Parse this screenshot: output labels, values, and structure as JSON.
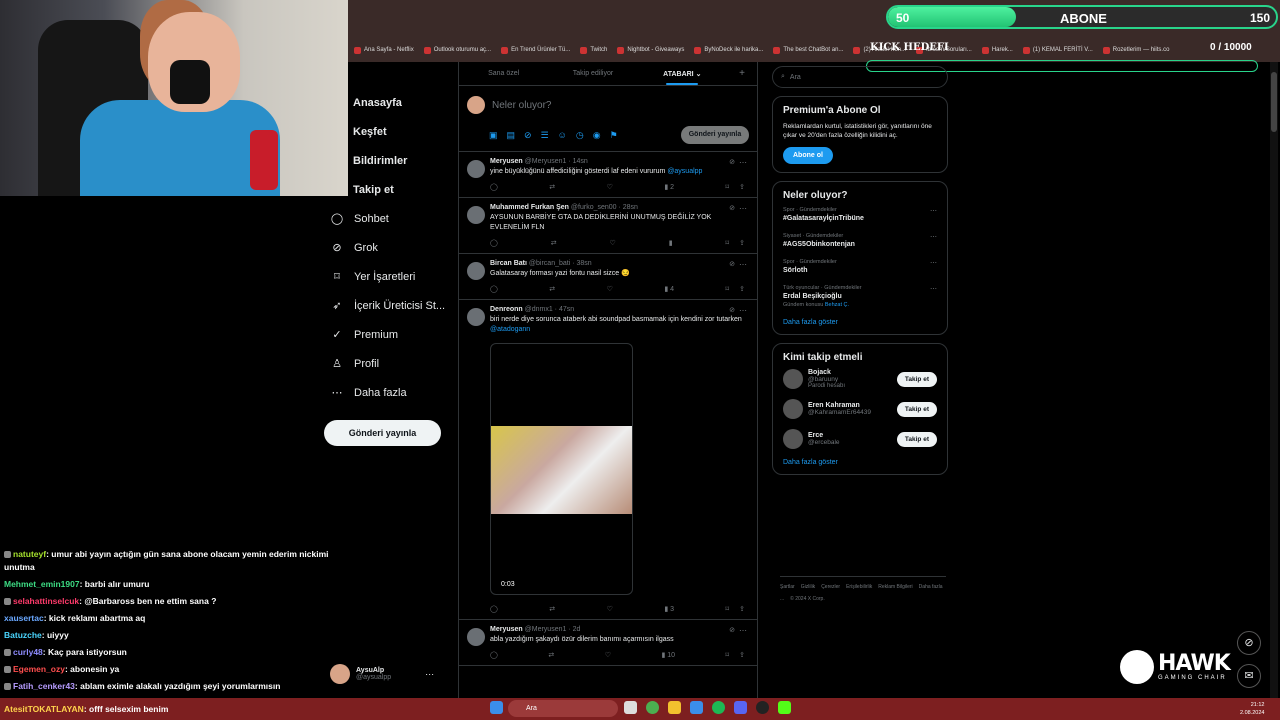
{
  "subbar": {
    "current": "50",
    "label": "ABONE",
    "goal": "150",
    "progress": 0.33
  },
  "kick": {
    "label": "KICK HEDEFI",
    "count": "0 / 10000"
  },
  "bookmarks": [
    "Ana Sayfa - Netflix",
    "Outlook oturumu aç...",
    "En Trend Ürünler Tü...",
    "Twitch",
    "Nightbot - Giveaways",
    "ByNoDeck ile harika...",
    "The best ChatBot an...",
    "(2) Aktüel Kon...",
    "fb.com/Soruları...",
    "Harek...",
    "(1) KEMAL FERİTİ V...",
    "Rozetlerim — hiits.co"
  ],
  "nav": {
    "items": [
      {
        "label": "Anasayfa",
        "icon": "home-icon"
      },
      {
        "label": "Keşfet",
        "icon": "explore-icon"
      },
      {
        "label": "Bildirimler",
        "icon": "bell-icon"
      },
      {
        "label": "Takip et",
        "icon": "follow-icon"
      },
      {
        "label": "Sohbet",
        "icon": "chat-icon",
        "glyph": "◯"
      },
      {
        "label": "Grok",
        "icon": "grok-icon",
        "glyph": "⊘"
      },
      {
        "label": "Yer İşaretleri",
        "icon": "bookmark-icon",
        "glyph": "⌑"
      },
      {
        "label": "İçerik Üreticisi St...",
        "icon": "rocket-icon",
        "glyph": "➶"
      },
      {
        "label": "Premium",
        "icon": "premium-icon",
        "glyph": "✓"
      },
      {
        "label": "Profil",
        "icon": "profile-icon",
        "glyph": "♙"
      },
      {
        "label": "Daha fazla",
        "icon": "more-icon",
        "glyph": "⋯"
      }
    ],
    "post_button": "Gönderi yayınla"
  },
  "profile": {
    "name": "AysuAlp",
    "handle": "@aysualpp"
  },
  "tabs": [
    "Sana özel",
    "Takip ediliyor",
    "ATABARI ⌄"
  ],
  "composer": {
    "placeholder": "Neler oluyor?",
    "post_label": "Gönderi yayınla"
  },
  "tweets": [
    {
      "name": "Meryusen",
      "meta": "@Meryusen1 · 14sn",
      "text": "yine büyüklüğünü affediciliğini gösterdi laf edeni vururum ",
      "mention": "@aysualpp",
      "views": "2"
    },
    {
      "name": "Muhammed Furkan Şen",
      "meta": "@furko_sen00 · 28sn",
      "text": "AYSUNUN BARBİYE GTA DA DEDİKLERİNİ UNUTMUŞ DEĞİLİZ YOK EVLENELİM FLN",
      "mention": "",
      "views": ""
    },
    {
      "name": "Bircan Batı",
      "meta": "@bircan_bati · 38sn",
      "text": "Galatasaray forması yazi fontu nasil sizce 😏",
      "mention": "",
      "views": "4"
    },
    {
      "name": "Denreonn",
      "meta": "@dnmx1 · 47sn",
      "text": "biri nerde diye sorunca ataberk abi soundpad basmamak için kendini zor tutarken ",
      "mention": "@atadogann",
      "views": "3",
      "video_time": "0:03"
    },
    {
      "name": "Meryusen",
      "meta": "@Meryusen1 · 2d",
      "text": "abla yazdığım şakaydı özür dilerim banımı açarmısın ilgass",
      "mention": "",
      "views": "10"
    }
  ],
  "search": {
    "placeholder": "Ara"
  },
  "premium": {
    "title": "Premium'a Abone Ol",
    "text": "Reklamlardan kurtul, istatistikleri gör, yanıtlarını öne çıkar ve 20'den fazla özelliğin kilidini aç.",
    "button": "Abone ol"
  },
  "trends": {
    "title": "Neler oluyor?",
    "items": [
      {
        "cat": "Spor · Gündemdekiler",
        "tag": "#GalatasarayİçinTribüne",
        "extra": "",
        "link": ""
      },
      {
        "cat": "Siyaset · Gündemdekiler",
        "tag": "#AGS5Obinkontenjan",
        "extra": "",
        "link": ""
      },
      {
        "cat": "Spor · Gündemdekiler",
        "tag": "Sörloth",
        "extra": "",
        "link": ""
      },
      {
        "cat": "Türk oyuncular · Gündemdekiler",
        "tag": "Erdal Beşikçioğlu",
        "extra": "Gündem konusu ",
        "link": "Behzat Ç."
      }
    ],
    "show_more": "Daha fazla göster"
  },
  "who": {
    "title": "Kimi takip etmeli",
    "items": [
      {
        "name": "Bojack",
        "handle": "@baruuny",
        "extra": "Parodi hesabı"
      },
      {
        "name": "Eren Kahraman",
        "handle": "@KahramamEr64439",
        "extra": ""
      },
      {
        "name": "Erce",
        "handle": "@ercebale",
        "extra": ""
      }
    ],
    "follow": "Takip et",
    "show_more": "Daha fazla göster"
  },
  "footer": [
    "Şartlar",
    "Gizlilik",
    "Çerezler",
    "Erişilebilirlik",
    "Reklam Bilgileri",
    "Daha fazla ...",
    "© 2024 X Corp."
  ],
  "chat": [
    {
      "user": "natuteyf",
      "color": "#a6e22e",
      "text": ": umur abi yayın açtığın gün sana abone olacam yemin ederim nickimi unutma"
    },
    {
      "user": "Mehmet_emin1907",
      "color": "#3ddc84",
      "text": ": barbi alır umuru"
    },
    {
      "user": "selahattinselcuk",
      "color": "#ff3b6b",
      "text": ": @Barbaross ben ne ettim sana ?"
    },
    {
      "user": "xausertac",
      "color": "#6aa8ff",
      "text": ": kick reklamı abartma aq"
    },
    {
      "user": "Batuzche",
      "color": "#4ad6ff",
      "text": ": uiyyy"
    },
    {
      "user": "curly48",
      "color": "#8f8cff",
      "text": ": Kaç para istiyorsun"
    },
    {
      "user": "Egemen_ozy",
      "color": "#ff4e4e",
      "text": ": abonesin ya"
    },
    {
      "user": "Fatih_cenker43",
      "color": "#b69cff",
      "text": ": ablam eximle alakalı yazdığım şeyi yorumlarmısın"
    }
  ],
  "last_chat": {
    "user": "AtesitTOKATLAYAN",
    "text": ": offf selsexim benim"
  },
  "taskbar": {
    "search": "Ara",
    "time": "21:12",
    "date": "2.08.2024"
  },
  "brand": {
    "name": "HAWK",
    "tag": "GAMING CHAIR"
  },
  "colors": {
    "accent": "#1d9bf0",
    "green": "#29d48b",
    "taskbar": "#7d1f20"
  }
}
